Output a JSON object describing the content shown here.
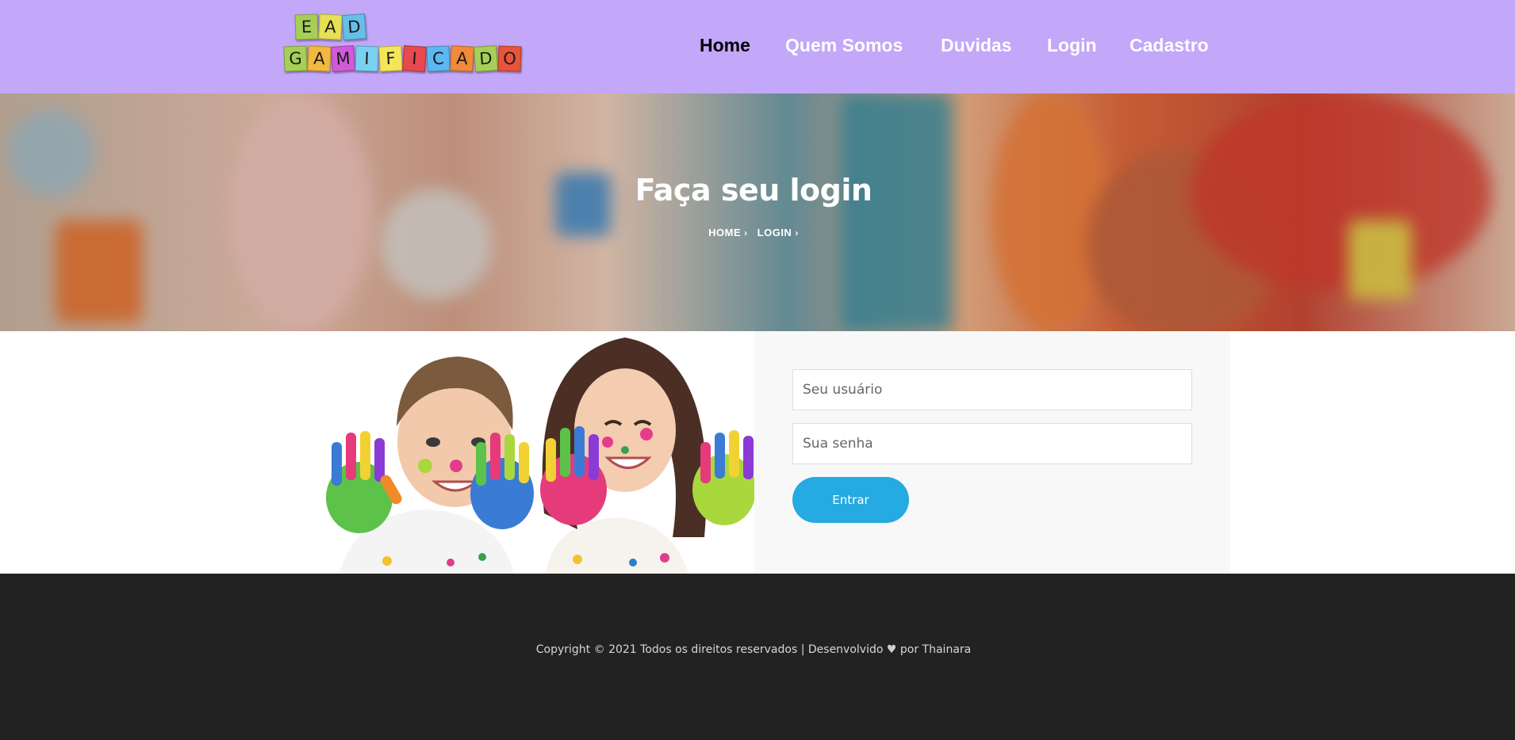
{
  "header": {
    "logo": {
      "row1": [
        "E",
        "A",
        "D"
      ],
      "row2": [
        "G",
        "A",
        "M",
        "I",
        "F",
        "I",
        "C",
        "A",
        "D",
        "O"
      ],
      "row1_colors": [
        "#a6cf57",
        "#e7df55",
        "#66bfe8"
      ],
      "row2_colors": [
        "#a6cf57",
        "#f2b83f",
        "#d05bd8",
        "#7ad0f0",
        "#f4e55a",
        "#e8484e",
        "#5bb8f0",
        "#f28a3a",
        "#a6cf57",
        "#e6543a"
      ]
    },
    "nav": [
      {
        "label": "Home",
        "active": true
      },
      {
        "label": "Quem Somos",
        "active": false
      },
      {
        "label": "Duvidas",
        "active": false
      },
      {
        "label": "Login",
        "active": false
      },
      {
        "label": "Cadastro",
        "active": false
      }
    ]
  },
  "hero": {
    "title": "Faça seu login",
    "breadcrumb": [
      {
        "label": "HOME",
        "icon": "chevron-right-icon"
      },
      {
        "label": "LOGIN",
        "icon": "chevron-right-icon"
      }
    ]
  },
  "login": {
    "username_placeholder": "Seu usuário",
    "password_placeholder": "Sua senha",
    "submit_label": "Entrar"
  },
  "footer": {
    "copyright_prefix": "Copyright © 2021 Todos os direitos reservados | Desenvolvido",
    "heart": "♥",
    "copyright_suffix": "por Thainara"
  },
  "colors": {
    "header_bg": "#c3a7f9",
    "button": "#25aae1",
    "footer_bg": "#222222"
  }
}
